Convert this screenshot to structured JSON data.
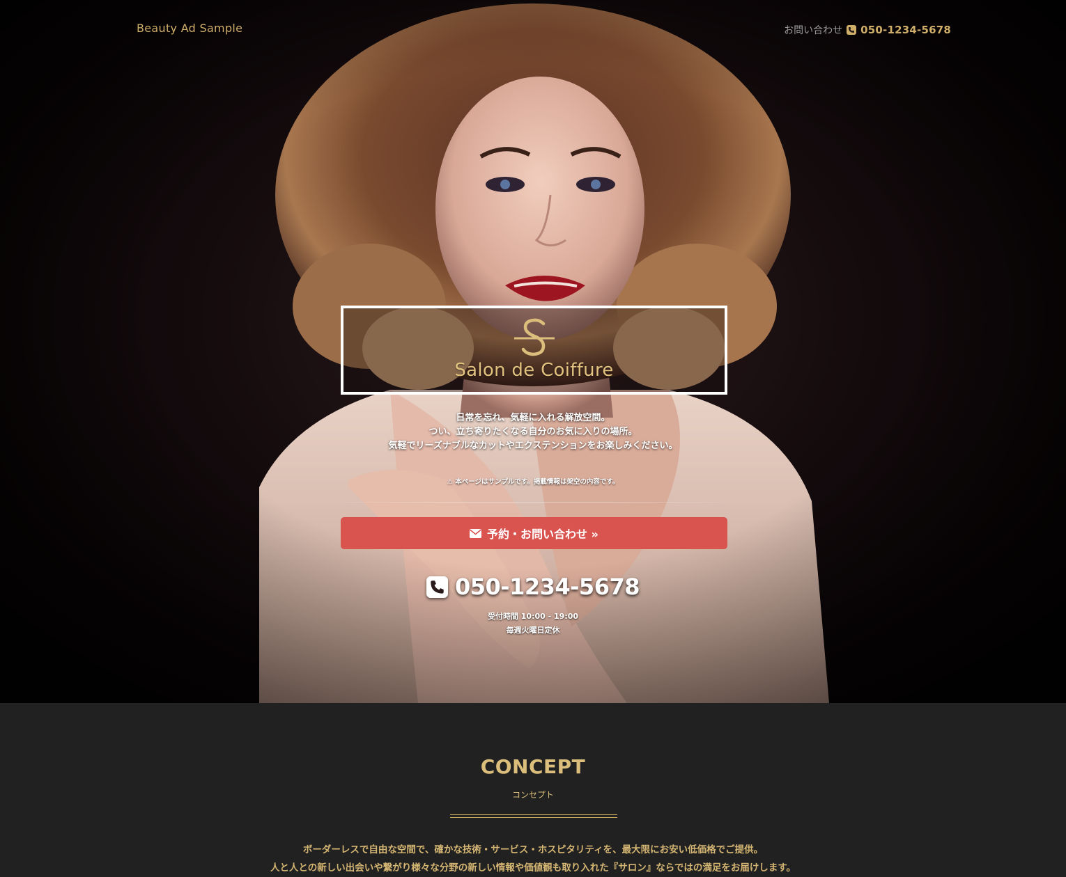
{
  "header": {
    "brand": "Beauty Ad Sample",
    "contact_label": "お問い合わせ",
    "phone": "050-1234-5678"
  },
  "hero": {
    "logo_text": "Salon de Coiffure",
    "lead_lines": [
      "日常を忘れ、気軽に入れる解放空間。",
      "つい、立ち寄りたくなる自分のお気に入りの場所。",
      "気軽でリーズナブルなカットやエクステンションをお楽しみください。"
    ],
    "notice": "本ページはサンプルです。掲載情報は架空の内容です。",
    "cta_label": "予約・お問い合わせ »",
    "phone": "050-1234-5678",
    "hours": "受付時間 10:00 - 19:00",
    "closed": "毎週火曜日定休"
  },
  "concept": {
    "title": "CONCEPT",
    "subtitle": "コンセプト",
    "body_lines": [
      "ボーダーレスで自由な空間で、確かな技術・サービス・ホスピタリティを、最大限にお安い低価格でご提供。",
      "人と人との新しい出会いや繋がり様々な分野の新しい情報や価値観も取り入れた『サロン』ならではの満足をお届けします。"
    ]
  },
  "colors": {
    "gold": "#cfae6a",
    "cta": "#d9534f",
    "dark_section": "#212121"
  }
}
